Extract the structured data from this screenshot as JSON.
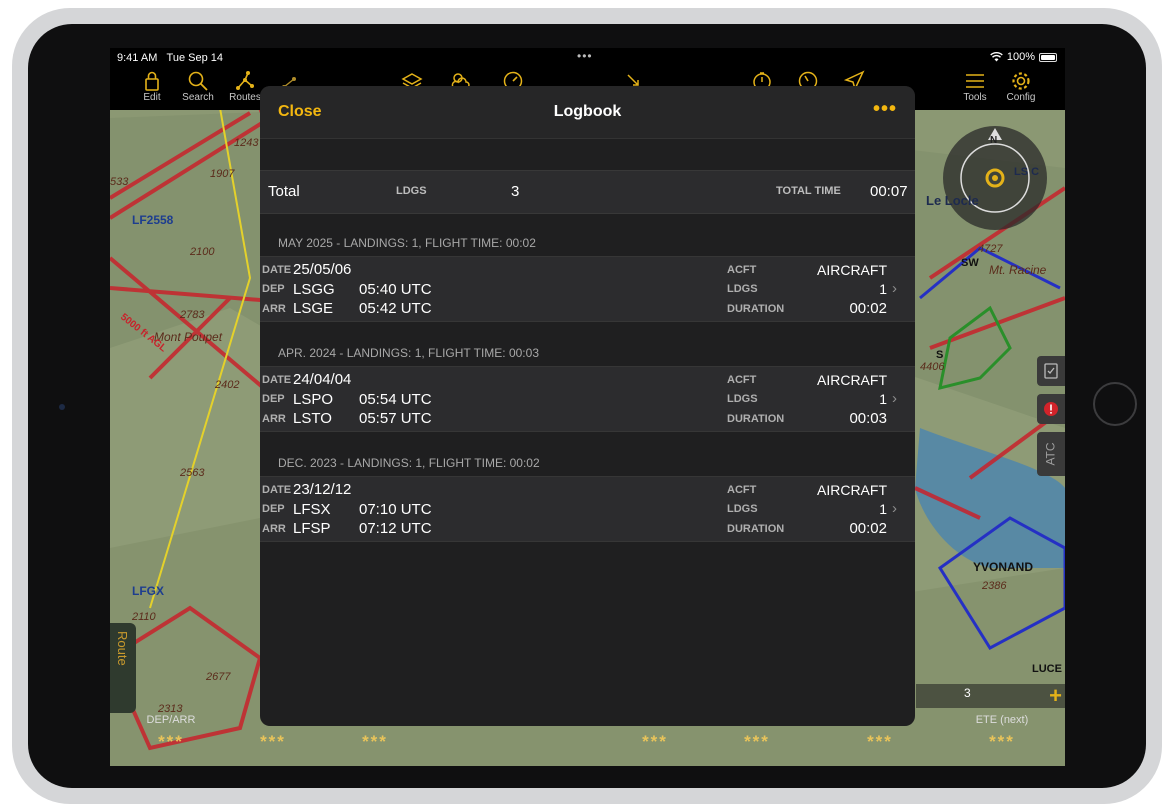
{
  "status_bar": {
    "time": "9:41 AM",
    "date": "Tue Sep 14",
    "center_dots": "•••",
    "battery": "100%"
  },
  "toolbar": {
    "edit": "Edit",
    "search": "Search",
    "routes": "Routes",
    "tools": "Tools",
    "config": "Config"
  },
  "logbook": {
    "close": "Close",
    "title": "Logbook",
    "more": "•••",
    "total": {
      "label": "Total",
      "ldgs_label": "LDGS",
      "ldgs": "3",
      "total_time_label": "TOTAL TIME",
      "total_time": "00:07"
    },
    "labels": {
      "date": "DATE",
      "dep": "DEP",
      "arr": "ARR",
      "acft": "ACFT",
      "ldgs": "LDGS",
      "duration": "DURATION"
    },
    "groups": [
      {
        "header": "MAY 2025 - LANDINGS: 1, FLIGHT TIME: 00:02",
        "entry": {
          "date": "25/05/06",
          "dep": "LSGG",
          "dep_time": "05:40 UTC",
          "arr": "LSGE",
          "arr_time": "05:42 UTC",
          "aircraft": "AIRCRAFT",
          "ldgs": "1",
          "duration": "00:02"
        }
      },
      {
        "header": "APR. 2024 - LANDINGS: 1, FLIGHT TIME: 00:03",
        "entry": {
          "date": "24/04/04",
          "dep": "LSPO",
          "dep_time": "05:54 UTC",
          "arr": "LSTO",
          "arr_time": "05:57 UTC",
          "aircraft": "AIRCRAFT",
          "ldgs": "1",
          "duration": "00:03"
        }
      },
      {
        "header": "DEC. 2023 - LANDINGS: 1, FLIGHT TIME: 00:02",
        "entry": {
          "date": "23/12/12",
          "dep": "LFSX",
          "dep_time": "07:10 UTC",
          "arr": "LFSP",
          "arr_time": "07:12 UTC",
          "aircraft": "AIRCRAFT",
          "ldgs": "1",
          "duration": "00:02"
        }
      }
    ]
  },
  "map": {
    "labels": {
      "lf2558": "LF2558",
      "lfgx": "LFGX",
      "mont_poupet": "Mont Poupet",
      "airspace_5000": "5000 ft AGL",
      "le_locle": "Le Locle",
      "sw": "SW",
      "mt_racine": "Mt. Racine",
      "yvonand": "YVONAND",
      "s": "S",
      "lu": "LUCE",
      "ls_c": "LS C",
      "compass_n": "N",
      "atc": "ATC"
    },
    "elevations": [
      "1243",
      "1907",
      "2100",
      "2783",
      "2402",
      "2563",
      "2110",
      "2677",
      "2313",
      "4727",
      "4406",
      "2386",
      "533"
    ]
  },
  "route_tab": "Route",
  "bottom_bar": {
    "dep_arr_label": "DEP/ARR",
    "ete_label": "ETE (next)",
    "placeholder": "***",
    "zoom_value": "3"
  },
  "colors": {
    "accent": "#f3b710",
    "panel": "#1f1f20",
    "row": "#2c2c2e"
  }
}
